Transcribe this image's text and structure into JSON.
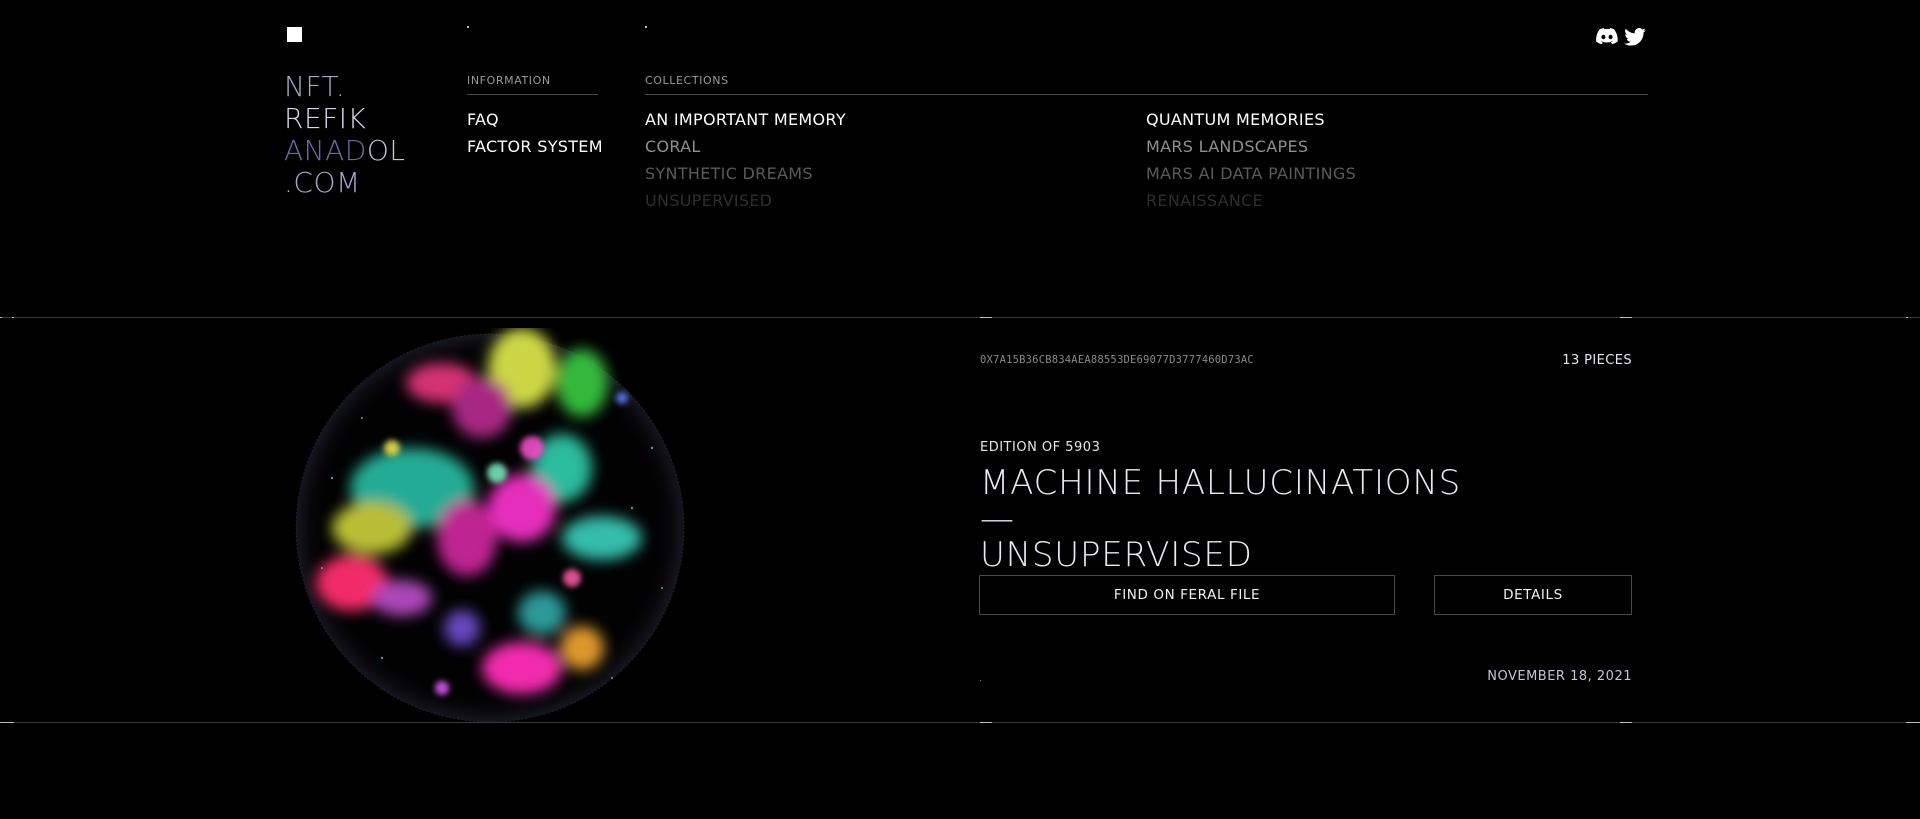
{
  "header": {
    "logo_lines": [
      "NFT.",
      "REFIK",
      "ANAD",
      "OL",
      ".COM"
    ]
  },
  "nav": {
    "information": {
      "heading": "INFORMATION",
      "links": [
        "FAQ",
        "FACTOR SYSTEM"
      ]
    },
    "collections": {
      "heading": "COLLECTIONS",
      "left": [
        "AN IMPORTANT MEMORY",
        "CORAL",
        "SYNTHETIC DREAMS",
        "UNSUPERVISED"
      ],
      "right": [
        "QUANTUM MEMORIES",
        "MARS LANDSCAPES",
        "MARS AI DATA PAINTINGS",
        "RENAISSANCE"
      ]
    },
    "social_icons": [
      "discord-icon",
      "twitter-icon"
    ]
  },
  "collection": {
    "contract": "0X7A15B36CB834AEA88553DE69077D3777460D73AC",
    "pieces": "13 PIECES",
    "edition": "EDITION OF 5903",
    "title_line1": "MACHINE HALLUCINATIONS —",
    "title_line2": "UNSUPERVISED",
    "buttons": {
      "feral": "FIND ON FERAL FILE",
      "details": "DETAILS"
    },
    "date": "NOVEMBER 18, 2021"
  },
  "colors": {
    "background": "#000000",
    "text": "#ffffff",
    "logo_accent": "#6d6aa6",
    "muted": "#8a8a8a"
  }
}
